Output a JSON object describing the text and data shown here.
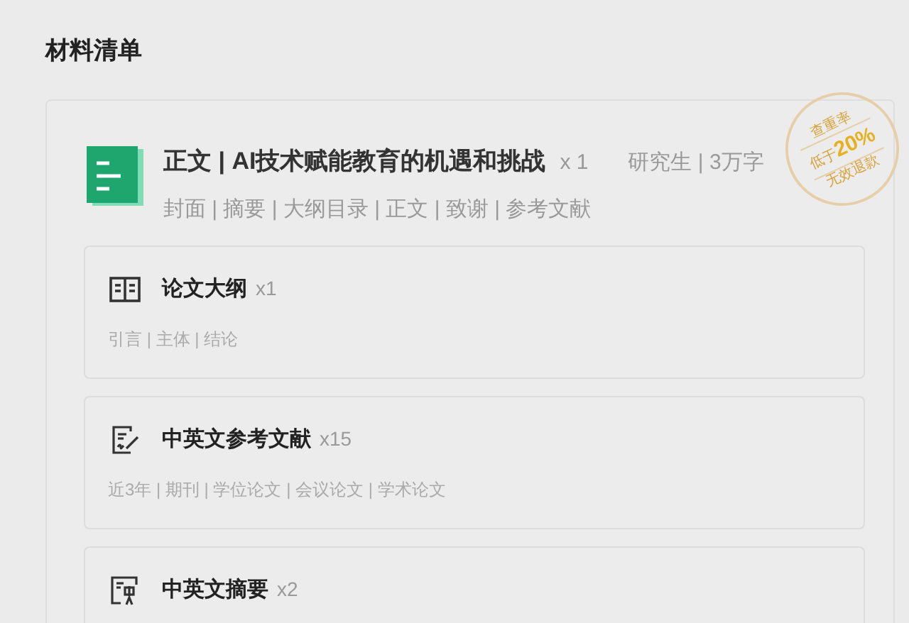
{
  "section_title": "材料清单",
  "main": {
    "title": "正文 | AI技术赋能教育的机遇和挑战",
    "count": "x 1",
    "meta": "研究生 | 3万字",
    "parts": "封面 | 摘要 | 大纲目录 | 正文 | 致谢 | 参考文献",
    "stamp": {
      "top": "查重率",
      "prefix": "低于",
      "value": "20%",
      "bottom": "无效退款"
    }
  },
  "items": [
    {
      "kind": "outline",
      "title": "论文大纲",
      "count": "x1",
      "tags": "引言 | 主体 | 结论"
    },
    {
      "kind": "references",
      "title": "中英文参考文献",
      "count": "x15",
      "tags": "近3年 | 期刊 | 学位论文 | 会议论文 | 学术论文"
    },
    {
      "kind": "abstract",
      "title": "中英文摘要",
      "count": "x2"
    }
  ]
}
